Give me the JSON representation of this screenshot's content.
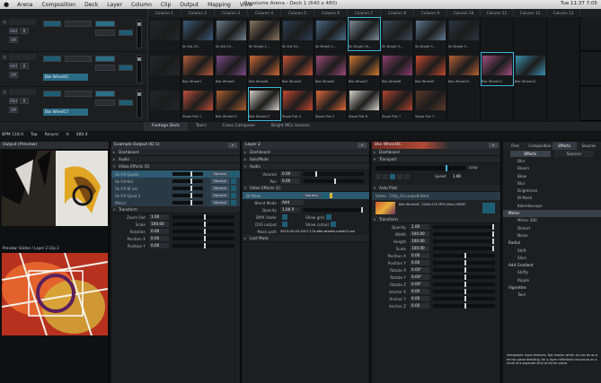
{
  "menubar": {
    "apple": "",
    "items": [
      "Arena",
      "Composition",
      "Deck",
      "Layer",
      "Column",
      "Clip",
      "Output",
      "Mapping",
      "View"
    ],
    "title": "Resolume Arena - Deck 1 (640 x 480)",
    "clock": "Tue 11:37 7:05"
  },
  "columns": [
    "Column 1",
    "Column 2",
    "Column 3",
    "Column 4",
    "Column 5",
    "Column 6",
    "Column 7",
    "Column 8",
    "Column 9",
    "Column 10",
    "Column 11",
    "Column 12",
    "Column 13"
  ],
  "layers": [
    {
      "name": "Layer 3",
      "b1": "Add",
      "b2": "B",
      "b3": "SM",
      "clips": [
        "",
        "Sk Kid 20...",
        "Sk Kid 25...",
        "Sk Bright 1...",
        "Sk Kid 30...",
        "Sk Bright 2...",
        "Sk Bright 25...",
        "Sk Bright 3...",
        "Sk Bright 5...",
        "Sk Bright 5..",
        "",
        "",
        ""
      ]
    },
    {
      "name": "Layer 2",
      "b1": "Add",
      "b2": "B",
      "b3": "SM",
      "tag": "Bke Wheel4C",
      "clips": [
        "",
        "Bke Wheel1",
        "Bke Wheel2",
        "Bke Wheel6",
        "Bke Wheel4",
        "Bke Wheel5",
        "Bke Wheel7",
        "Bke Wheel8",
        "Bke Wheel9",
        "Bke Wheel10",
        "Bke Wheel11",
        "Bke Wheel12",
        ""
      ]
    },
    {
      "name": "Layer 1",
      "b1": "Add",
      "b2": "B",
      "b3": "SM",
      "tag": "Bke Wheel17",
      "clips": [
        "",
        "Slope Flat 1",
        "Bke Wheel13",
        "Bke Wheel17",
        "Slope Flat 4",
        "Slope Flat 5",
        "Slope Flat 6",
        "Slope Flat 7",
        "Slope Flat 7..",
        "",
        "",
        "",
        ""
      ]
    }
  ],
  "decktabs": [
    "Footage Deck",
    "Tears",
    "Cross Composer",
    "Bright MCL lessons"
  ],
  "status": {
    "bpm": "BPM 118.0",
    "tap": "Tap",
    "resync": "Resync",
    "a": "A",
    "value": "480.4"
  },
  "preview": {
    "title": "Output (Preview)",
    "sub": "Preview: Slicker / Layer 2 Clip 2"
  },
  "composition": {
    "title": "Example Output (ID 1)",
    "sections": [
      "Dashboard",
      "Audio",
      "Video Effects (5)"
    ],
    "effects": [
      {
        "name": "Sk Fill Quads",
        "mode": "Normal"
      },
      {
        "name": "Sk Fill Kid",
        "mode": "Normal"
      },
      {
        "name": "Sk Fill Bl Ler",
        "mode": "Normal"
      },
      {
        "name": "Sk Fill Quad 2",
        "mode": "Normal"
      },
      {
        "name": "Mirror",
        "mode": "Normal"
      }
    ],
    "transform": "Transform",
    "rows": [
      {
        "k": "Zoom Out",
        "v": "1.00"
      },
      {
        "k": "Scale",
        "v": "100.00"
      },
      {
        "k": "Rotation",
        "v": "0.00"
      },
      {
        "k": "Position X",
        "v": "0.00"
      },
      {
        "k": "Position Y",
        "v": "0.00"
      }
    ]
  },
  "layerpanel": {
    "title": "Layer 2",
    "sections": [
      "Dashboard",
      "Solo/Mute",
      "Audio"
    ],
    "vol": "Volume",
    "volv": "0.00",
    "pan": "Pan",
    "panv": "0.00",
    "effects": "Video Effects (1)",
    "fx": "Bl Mask",
    "fxmode": "Normal",
    "blend": "Blend Mode",
    "blendv": "Add",
    "opacity": "Opacity",
    "opacityv": "1.00 P",
    "rows": [
      {
        "k": "DMX Vader",
        "v": "Show grid"
      },
      {
        "k": "DVS output",
        "v": "Show cutout"
      }
    ],
    "path": "Mask path",
    "pathv": "2013-05-30-2017-17a-bke-wheels-mask12.avi",
    "last": "Last Mask"
  },
  "clippanel": {
    "title": "Bke Wheel4C",
    "sections": [
      "Dashboard",
      "Transport",
      "Auto Pilot"
    ],
    "timeline": "Timeline",
    "tl": "Loop",
    "speed": "Speed",
    "speedv": "1.00",
    "clipinfo": "Video: 720p_Gt:LoopsB-Bast",
    "clipdesc": "Bke Wheel4C 1280x720 MP4 (Mac) MWM",
    "transform": "Transform",
    "rows": [
      {
        "k": "Opacity",
        "v": "1.00"
      },
      {
        "k": "Width",
        "v": "100.00"
      },
      {
        "k": "Height",
        "v": "100.00"
      },
      {
        "k": "Scale",
        "v": "100.00"
      },
      {
        "k": "Position X",
        "v": "0.00"
      },
      {
        "k": "Position Y",
        "v": "0.00"
      },
      {
        "k": "Rotate X",
        "v": "0.00°"
      },
      {
        "k": "Rotate Y",
        "v": "0.00°"
      },
      {
        "k": "Rotate Z",
        "v": "0.00°"
      },
      {
        "k": "Anchor X",
        "v": "0.00"
      },
      {
        "k": "Anchor Y",
        "v": "0.00"
      },
      {
        "k": "Anchor Z",
        "v": "0.00"
      }
    ]
  },
  "rightpanel": {
    "tabs": [
      "Files",
      "Composition",
      "Effects",
      "Sources"
    ],
    "subtabs": [
      "Effects",
      "Sources"
    ],
    "items": [
      {
        "t": "Blur",
        "h": false
      },
      {
        "t": "Bloom",
        "h": false
      },
      {
        "t": "Blow",
        "h": false
      },
      {
        "t": "Blur",
        "h": false
      },
      {
        "t": "Brightness",
        "h": false
      },
      {
        "t": "Bl Mask",
        "h": false
      },
      {
        "t": "Kaleidoscope",
        "h": false
      },
      {
        "t": "Mirror",
        "h": true
      },
      {
        "t": "Mirror 360",
        "h": false
      },
      {
        "t": "Distort",
        "h": false
      },
      {
        "t": "Noise",
        "h": false
      },
      {
        "t": "Radial",
        "h": true
      },
      {
        "t": "Shift",
        "h": false
      },
      {
        "t": "Slice",
        "h": false
      },
      {
        "t": "Add Gradient",
        "h": true
      },
      {
        "t": "Shifty",
        "h": false
      },
      {
        "t": "Ripple",
        "h": false
      },
      {
        "t": "Vignettes",
        "h": true
      },
      {
        "t": "Twirl",
        "h": false
      }
    ],
    "desc": "Interpolate input textures, Dot motion which all can be as a mirror plane blending, for a layer reflections mount as on a ritual of a separate kind of mirror plane."
  }
}
